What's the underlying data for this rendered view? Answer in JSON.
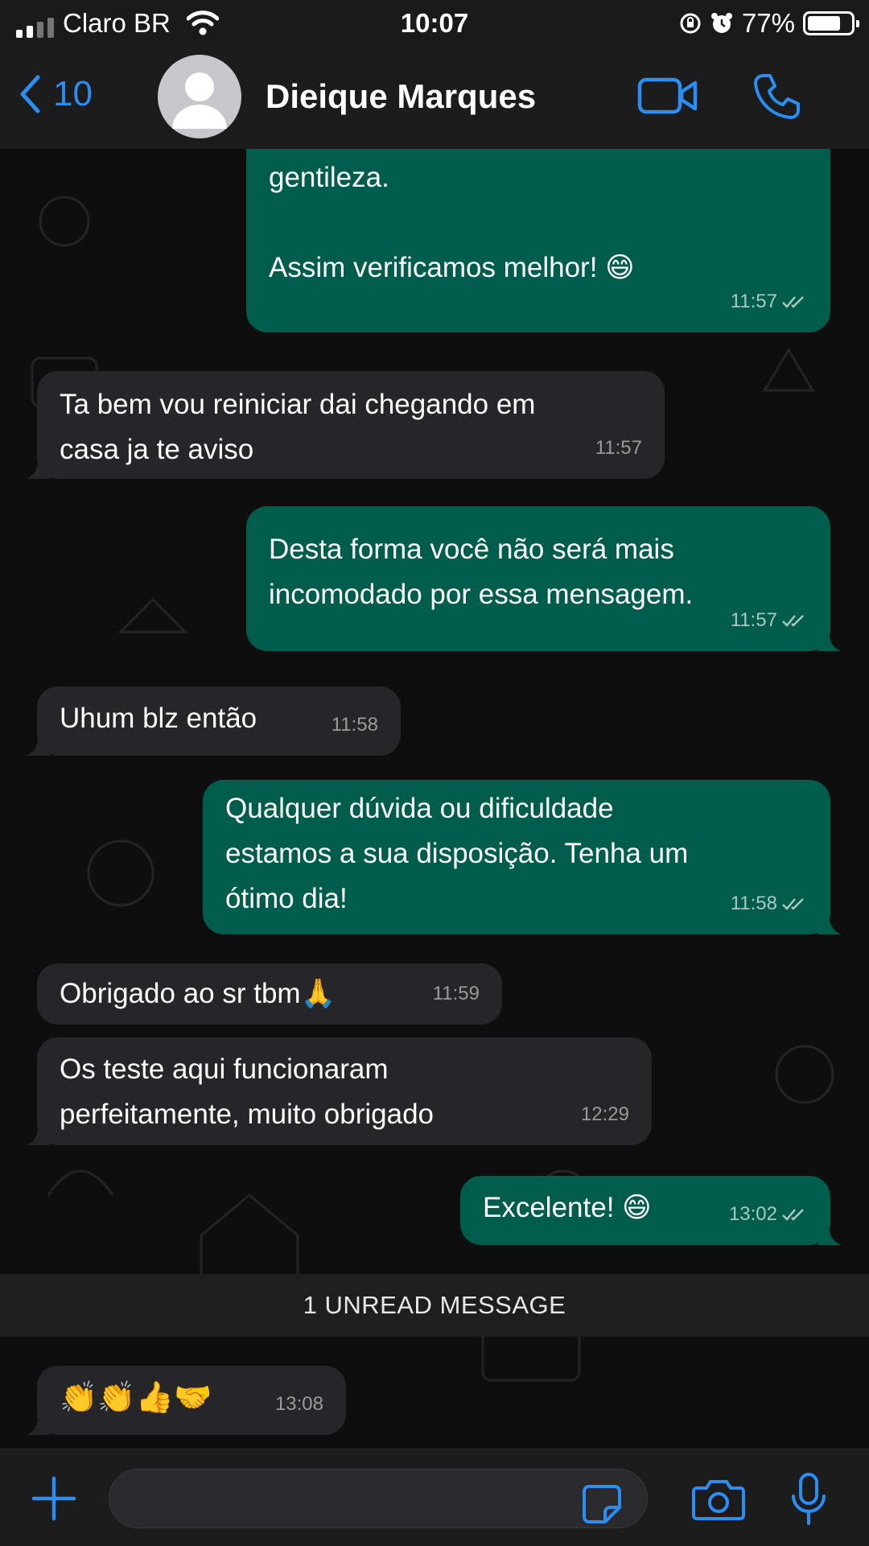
{
  "status_bar": {
    "carrier": "Claro BR",
    "time": "10:07",
    "battery": "77%",
    "battery_level": 0.77
  },
  "header": {
    "back_count": "10",
    "contact_name": "Dieique Marques"
  },
  "messages": [
    {
      "direction": "out",
      "text": "gentileza.\n\nAssim verificamos melhor! 😄",
      "time": "11:57",
      "read": true
    },
    {
      "direction": "in",
      "text": "Ta bem vou reiniciar dai chegando em\ncasa ja te aviso",
      "time": "11:57"
    },
    {
      "direction": "out",
      "text": "Desta forma você não será mais\nincomodado por essa mensagem.",
      "time": "11:57",
      "read": true
    },
    {
      "direction": "in",
      "text": "Uhum blz então",
      "time": "11:58"
    },
    {
      "direction": "out",
      "text": "Qualquer dúvida ou dificuldade\nestamos a sua disposição. Tenha um\nótimo dia!",
      "time": "11:58",
      "read": true
    },
    {
      "direction": "in",
      "text": "Obrigado ao sr tbm🙏",
      "time": "11:59"
    },
    {
      "direction": "in",
      "text": "Os teste aqui funcionaram\nperfeitamente, muito obrigado",
      "time": "12:29"
    },
    {
      "direction": "out",
      "text": "Excelente! 😄",
      "time": "13:02",
      "read": true
    },
    {
      "direction": "in",
      "text": "👏👏👍🤝",
      "time": "13:08"
    }
  ],
  "unread_banner": "1 UNREAD MESSAGE",
  "input": {
    "value": "",
    "placeholder": ""
  },
  "colors": {
    "accent": "#2a8ef5",
    "outgoing_bubble": "#005c4b",
    "incoming_bubble": "#262628",
    "background": "#0e0e0e"
  }
}
